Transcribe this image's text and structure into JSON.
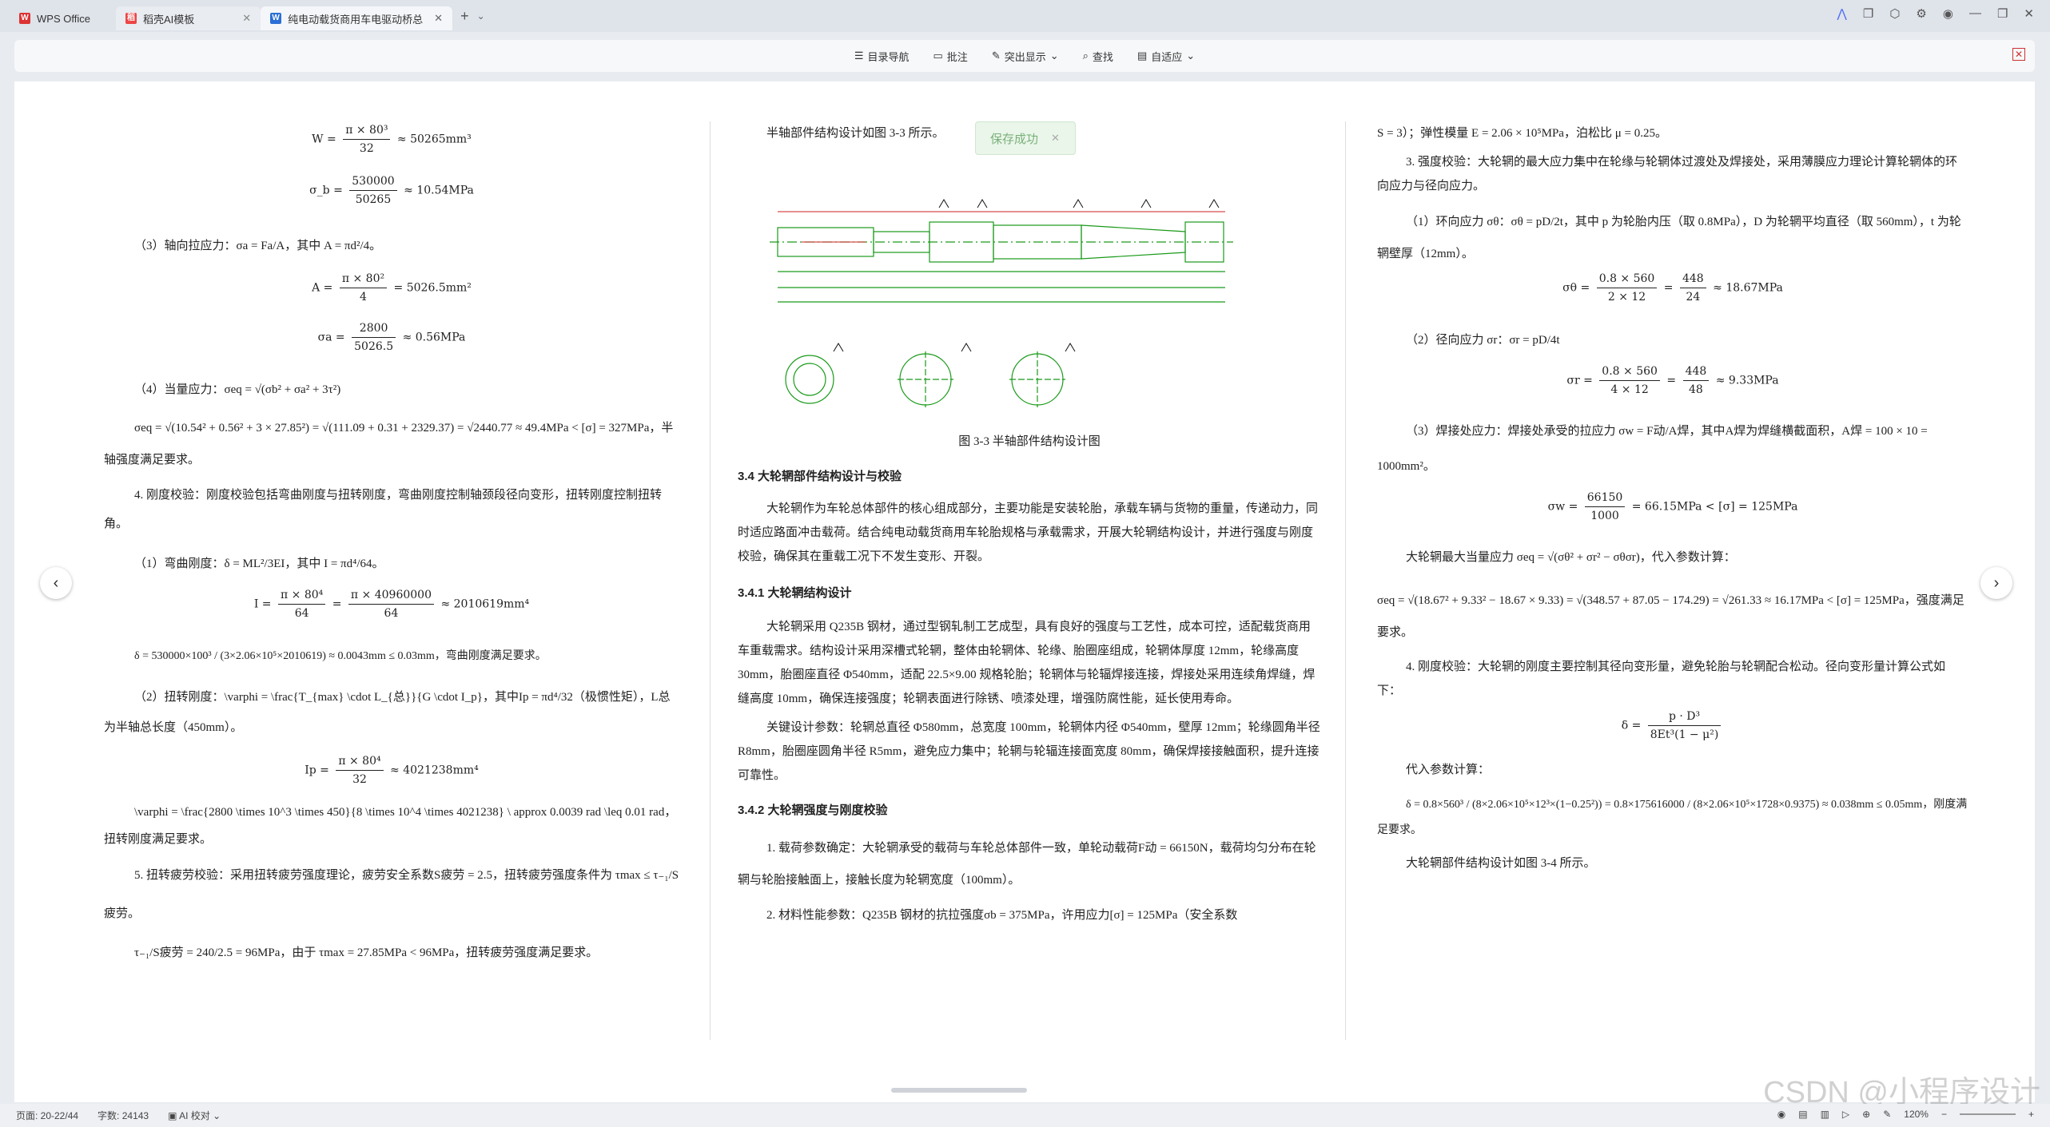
{
  "tabs": [
    {
      "label": "WPS Office",
      "icon": "W"
    },
    {
      "label": "稻壳AI模板",
      "icon": "稻"
    },
    {
      "label": "纯电动载货商用车电驱动桥总",
      "icon": "W"
    }
  ],
  "toolbar": {
    "nav": "目录导航",
    "comment": "批注",
    "highlight": "突出显示",
    "find": "查找",
    "fit": "自适应"
  },
  "toast": {
    "text": "保存成功"
  },
  "left": {
    "l1": "W = ",
    "l1n": "π × 80³",
    "l1d": "32",
    "l1r": " ≈ 50265mm³",
    "l2": "σ_b = ",
    "l2n": "530000",
    "l2d": "50265",
    "l2r": " ≈ 10.54MPa",
    "p3": "（3）轴向拉应力：σa = Fa/A，其中 A = πd²/4。",
    "l4": "A = ",
    "l4n": "π × 80²",
    "l4d": "4",
    "l4r": " = 5026.5mm²",
    "l5": "σa = ",
    "l5n": "2800",
    "l5d": "5026.5",
    "l5r": " ≈ 0.56MPa",
    "p6": "（4）当量应力：σeq = √(σb² + σa² + 3τ²)",
    "p7": "σeq = √(10.54² + 0.56² + 3 × 27.85²) = √(111.09 + 0.31 + 2329.37) = √2440.77 ≈ 49.4MPa < [σ] = 327MPa，半轴强度满足要求。",
    "p8": "4. 刚度校验：刚度校验包括弯曲刚度与扭转刚度，弯曲刚度控制轴颈段径向变形，扭转刚度控制扭转角。",
    "p9": "（1）弯曲刚度：δ = ML²/3EI，其中 I = πd⁴/64。",
    "l10": "I = ",
    "l10n": "π × 80⁴",
    "l10d": "64",
    "l10m": " = ",
    "l10n2": "π × 40960000",
    "l10d2": "64",
    "l10r": " ≈ 2010619mm⁴",
    "p11": "δ = 530000×100³ / (3×2.06×10⁵×2010619) ≈ 0.0043mm ≤ 0.03mm，弯曲刚度满足要求。",
    "p12": "（2）扭转刚度：\\varphi = \\frac{T_{max} \\cdot L_{总}}{G \\cdot I_p}，其中Ip = πd⁴/32（极惯性矩），L总为半轴总长度（450mm）。",
    "l13": "Ip = ",
    "l13n": "π × 80⁴",
    "l13d": "32",
    "l13r": " ≈ 4021238mm⁴",
    "p14": "\\varphi = \\frac{2800 \\times 10^3 \\times 450}{8 \\times 10^4 \\times 4021238} \\ approx 0.0039 rad \\leq 0.01 rad，扭转刚度满足要求。",
    "p15": "5. 扭转疲劳校验：采用扭转疲劳强度理论，疲劳安全系数S疲劳 = 2.5，扭转疲劳强度条件为 τmax ≤ τ₋₁/S疲劳。",
    "p16": "τ₋₁/S疲劳 = 240/2.5 = 96MPa，由于 τmax = 27.85MPa < 96MPa，扭转疲劳强度满足要求。"
  },
  "middle": {
    "p1": "半轴部件结构设计如图 3-3 所示。",
    "caption": "图 3-3 半轴部件结构设计图",
    "h1": "3.4 大轮辋部件结构设计与校验",
    "p2": "大轮辋作为车轮总体部件的核心组成部分，主要功能是安装轮胎，承载车辆与货物的重量，传递动力，同时适应路面冲击载荷。结合纯电动载货商用车轮胎规格与承载需求，开展大轮辋结构设计，并进行强度与刚度校验，确保其在重载工况下不发生变形、开裂。",
    "h2": "3.4.1 大轮辋结构设计",
    "p3": "大轮辋采用 Q235B 钢材，通过型钢轧制工艺成型，具有良好的强度与工艺性，成本可控，适配载货商用车重载需求。结构设计采用深槽式轮辋，整体由轮辋体、轮缘、胎圈座组成，轮辋体厚度 12mm，轮缘高度 30mm，胎圈座直径 Φ540mm，适配 22.5×9.00 规格轮胎；轮辋体与轮辐焊接连接，焊接处采用连续角焊缝，焊缝高度 10mm，确保连接强度；轮辋表面进行除锈、喷漆处理，增强防腐性能，延长使用寿命。",
    "p4": "关键设计参数：轮辋总直径 Φ580mm，总宽度 100mm，轮辋体内径 Φ540mm，壁厚 12mm；轮缘圆角半径 R8mm，胎圈座圆角半径 R5mm，避免应力集中；轮辋与轮辐连接面宽度 80mm，确保焊接接触面积，提升连接可靠性。",
    "h3": "3.4.2 大轮辋强度与刚度校验",
    "p5": "1. 载荷参数确定：大轮辋承受的载荷与车轮总体部件一致，单轮动载荷F动 = 66150N，载荷均匀分布在轮辋与轮胎接触面上，接触长度为轮辋宽度（100mm）。",
    "p6": "2. 材料性能参数：Q235B 钢材的抗拉强度σb = 375MPa，许用应力[σ] = 125MPa（安全系数"
  },
  "right": {
    "p1": "S = 3）；弹性模量 E = 2.06 × 10⁵MPa，泊松比 μ = 0.25。",
    "p2": "3. 强度校验：大轮辋的最大应力集中在轮缘与轮辋体过渡处及焊接处，采用薄膜应力理论计算轮辋体的环向应力与径向应力。",
    "p3": "（1）环向应力 σθ：σθ = pD/2t，其中 p 为轮胎内压（取 0.8MPa），D 为轮辋平均直径（取 560mm），t 为轮辋壁厚（12mm）。",
    "l4": "σθ = ",
    "l4n": "0.8 × 560",
    "l4d": "2 × 12",
    "l4m": " = ",
    "l4n2": "448",
    "l4d2": "24",
    "l4r": " ≈ 18.67MPa",
    "p5": "（2）径向应力 σr：σr = pD/4t",
    "l6": "σr = ",
    "l6n": "0.8 × 560",
    "l6d": "4 × 12",
    "l6m": " = ",
    "l6n2": "448",
    "l6d2": "48",
    "l6r": " ≈ 9.33MPa",
    "p7": "（3）焊接处应力：焊接处承受的拉应力 σw = F动/A焊，其中A焊为焊缝横截面积，A焊 = 100 × 10 = 1000mm²。",
    "l8": "σw = ",
    "l8n": "66150",
    "l8d": "1000",
    "l8r": " = 66.15MPa < [σ] = 125MPa",
    "p9": "大轮辋最大当量应力 σeq = √(σθ² + σr² − σθσr)，代入参数计算：",
    "p10": "σeq = √(18.67² + 9.33² − 18.67 × 9.33) = √(348.57 + 87.05 − 174.29) = √261.33 ≈ 16.17MPa < [σ] = 125MPa，强度满足要求。",
    "p11": "4. 刚度校验：大轮辋的刚度主要控制其径向变形量，避免轮胎与轮辋配合松动。径向变形量计算公式如下：",
    "l12": "δ = ",
    "l12n": "p · D³",
    "l12d": "8Et³(1 − μ²)",
    "p13": "代入参数计算：",
    "p14": "δ = 0.8×560³ / (8×2.06×10⁵×12³×(1−0.25²)) = 0.8×175616000 / (8×2.06×10⁵×1728×0.9375) ≈ 0.038mm ≤ 0.05mm，刚度满足要求。",
    "p15": "大轮辋部件结构设计如图 3-4 所示。"
  },
  "status": {
    "page": "页面: 20-22/44",
    "words": "字数: 24143",
    "ai": "AI 校对",
    "zoom": "120%"
  },
  "watermark": "CSDN @小程序设计"
}
